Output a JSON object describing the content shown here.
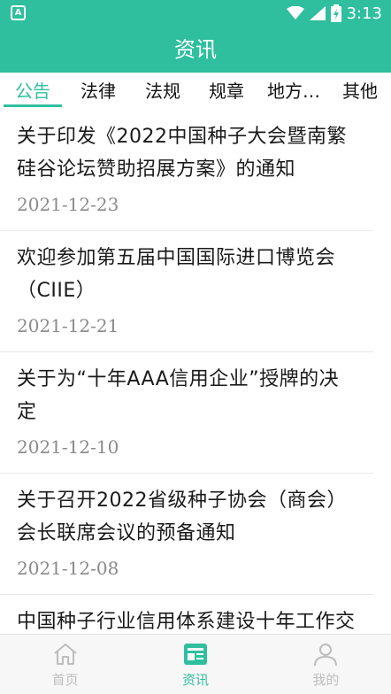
{
  "status_bar": {
    "left_icon_label": "A",
    "time": "3:13",
    "icons": [
      "wifi-icon",
      "signal-icon",
      "battery-icon"
    ]
  },
  "app_bar": {
    "title": "资讯"
  },
  "tabs": [
    {
      "label": "公告",
      "active": true
    },
    {
      "label": "法律",
      "active": false
    },
    {
      "label": "法规",
      "active": false
    },
    {
      "label": "规章",
      "active": false
    },
    {
      "label": "地方…",
      "active": false
    },
    {
      "label": "其他",
      "active": false
    }
  ],
  "news": [
    {
      "title": "关于印发《2022中国种子大会暨南繁硅谷论坛赞助招展方案》的通知",
      "date": "2021-12-23"
    },
    {
      "title": "欢迎参加第五届中国国际进口博览会（CIIE）",
      "date": "2021-12-21"
    },
    {
      "title": "关于为“十年AAA信用企业”授牌的决定",
      "date": "2021-12-10"
    },
    {
      "title": "关于召开2022省级种子协会（商会）会长联席会议的预备通知",
      "date": "2021-12-08"
    },
    {
      "title": "中国种子行业信用体系建设十年工作交流会邀请函",
      "date": ""
    }
  ],
  "bottom_nav": [
    {
      "label": "首页",
      "icon": "home-icon",
      "active": false
    },
    {
      "label": "资讯",
      "icon": "news-icon",
      "active": true
    },
    {
      "label": "我的",
      "icon": "profile-icon",
      "active": false
    }
  ],
  "colors": {
    "primary": "#2fbf9f",
    "inactive": "#bdbdbd",
    "date": "#8a8a8a"
  }
}
